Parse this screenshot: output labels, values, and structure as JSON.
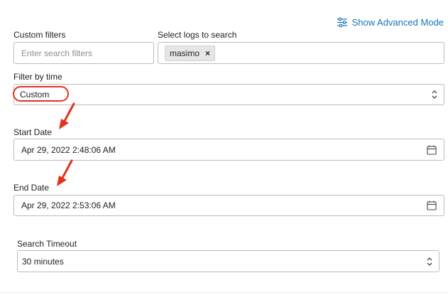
{
  "header": {
    "advanced_mode_label": "Show Advanced Mode",
    "advanced_mode_icon": "sliders-icon"
  },
  "custom_filters": {
    "label": "Custom filters",
    "placeholder": "Enter search filters",
    "value": ""
  },
  "select_logs": {
    "label": "Select logs to search",
    "chips": [
      {
        "label": "masimo",
        "remove_icon": "close-icon"
      }
    ]
  },
  "filter_by_time": {
    "label": "Filter by time",
    "selected": "Custom"
  },
  "start_date": {
    "label": "Start Date",
    "value": "Apr 29, 2022 2:48:06 AM",
    "icon": "calendar-icon"
  },
  "end_date": {
    "label": "End Date",
    "value": "Apr 29, 2022 2:53:06 AM",
    "icon": "calendar-icon"
  },
  "search_timeout": {
    "label": "Search Timeout",
    "selected": "30 minutes"
  },
  "colors": {
    "accent": "#1a73b8",
    "annotation": "#e3321f",
    "border": "#b8bcc2",
    "chip_bg": "#e6e6e6"
  }
}
